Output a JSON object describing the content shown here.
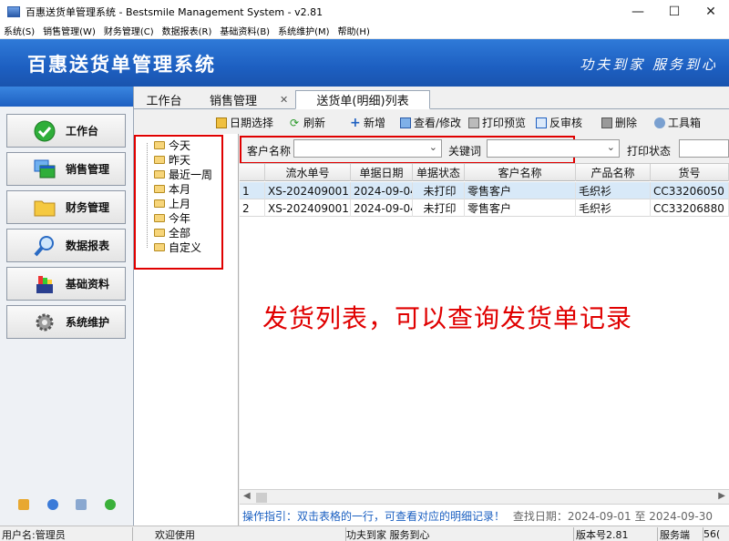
{
  "window": {
    "title": "百惠送货单管理系统 - Bestsmile Management System - v2.81",
    "controls": [
      "—",
      "☐",
      "✕"
    ]
  },
  "menu": [
    "系统(S)",
    "销售管理(W)",
    "财务管理(C)",
    "数据报表(R)",
    "基础资料(B)",
    "系统维护(M)",
    "帮助(H)"
  ],
  "banner": {
    "app_title": "百惠送货单管理系统",
    "slogan": "功夫到家 服务到心"
  },
  "nav": [
    {
      "label": "工作台",
      "icon": "check-circle-icon"
    },
    {
      "label": "销售管理",
      "icon": "windows-stack-icon"
    },
    {
      "label": "财务管理",
      "icon": "folder-icon"
    },
    {
      "label": "数据报表",
      "icon": "magnifier-icon"
    },
    {
      "label": "基础资料",
      "icon": "palette-icon"
    },
    {
      "label": "系统维护",
      "icon": "gear-icon"
    }
  ],
  "tabs": [
    {
      "label": "工作台"
    },
    {
      "label": "销售管理"
    },
    {
      "label": "送货单(明细)列表"
    }
  ],
  "toolbar": [
    "日期选择",
    "刷新",
    "新增",
    "查看/修改",
    "打印预览",
    "反审核",
    "删除",
    "工具箱"
  ],
  "tree": [
    "今天",
    "昨天",
    "最近一周",
    "本月",
    "上月",
    "今年",
    "全部",
    "自定义"
  ],
  "search": {
    "customer_label": "客户名称",
    "keyword_label": "关键词",
    "print_status_label": "打印状态"
  },
  "grid": {
    "columns": [
      "",
      "流水单号",
      "单据日期",
      "单据状态",
      "客户名称",
      "产品名称",
      "货号"
    ],
    "rows": [
      [
        "1",
        "XS-202409001",
        "2024-09-04",
        "未打印",
        "零售客户",
        "毛织衫",
        "CC33206050"
      ],
      [
        "2",
        "XS-202409001",
        "2024-09-04",
        "未打印",
        "零售客户",
        "毛织衫",
        "CC33206880"
      ]
    ]
  },
  "annotation": "发货列表，可以查询发货单记录",
  "guide": {
    "hint": "操作指引：双击表格的一行，可查看对应的明细记录！",
    "range": "查找日期：2024-09-01 至 2024-09-30"
  },
  "status": {
    "user": "用户名:管理员",
    "welcome": "欢迎使用",
    "slogan": "功夫到家 服务到心",
    "version": "版本号2.81",
    "server": "服务端",
    "server_tail": "56("
  }
}
